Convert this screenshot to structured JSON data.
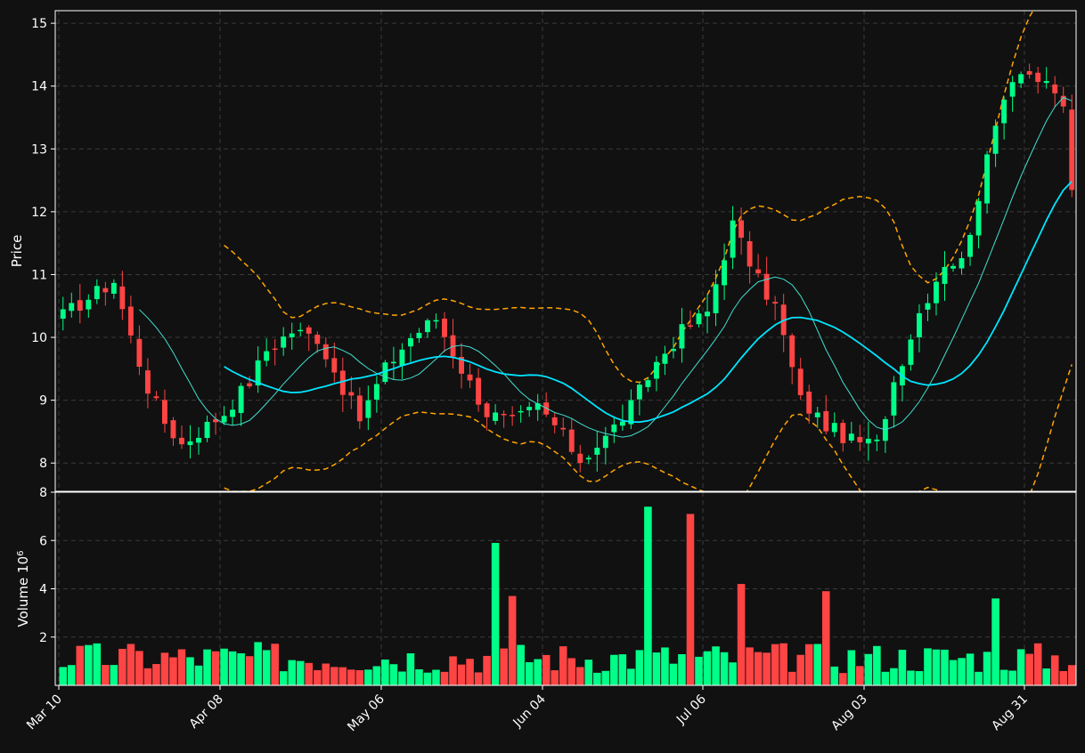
{
  "chart_data": {
    "type": "candlestick",
    "x_ticks": [
      "Mar 10",
      "Apr 08",
      "May 06",
      "Jun 04",
      "Jul 06",
      "Aug 03",
      "Aug 31"
    ],
    "panels": [
      {
        "name": "price",
        "ylabel": "Price",
        "ylim": [
          7.55,
          15.2
        ],
        "y_ticks": [
          "8",
          "9",
          "10",
          "11",
          "12",
          "13",
          "14",
          "15"
        ],
        "grid": true
      },
      {
        "name": "volume",
        "ylabel": "Volume",
        "ylabel_exponent": "6",
        "ylim": [
          0,
          8
        ],
        "y_ticks": [
          "2",
          "4",
          "6",
          "8"
        ],
        "grid": true
      }
    ],
    "colors": {
      "up": "#00ff88",
      "down": "#ff4444",
      "ma_short": "#40e0d0",
      "ma_long": "#00e5ff",
      "bands": "#ffa500",
      "grid": "#3a3a3a",
      "axis": "#ffffff"
    },
    "close_keypoints": [
      [
        0,
        10.35
      ],
      [
        6,
        10.9
      ],
      [
        8,
        10.0
      ],
      [
        10,
        9.2
      ],
      [
        12,
        8.65
      ],
      [
        14,
        8.3
      ],
      [
        19,
        8.8
      ],
      [
        22,
        9.3
      ],
      [
        24,
        9.8
      ],
      [
        27,
        10.1
      ],
      [
        30,
        10.0
      ],
      [
        33,
        9.2
      ],
      [
        35,
        8.7
      ],
      [
        38,
        9.5
      ],
      [
        41,
        10.0
      ],
      [
        44,
        10.3
      ],
      [
        47,
        9.5
      ],
      [
        50,
        8.8
      ],
      [
        53,
        8.65
      ],
      [
        56,
        8.9
      ],
      [
        58,
        8.6
      ],
      [
        61,
        8.05
      ],
      [
        64,
        8.4
      ],
      [
        67,
        8.9
      ],
      [
        70,
        9.6
      ],
      [
        73,
        10.1
      ],
      [
        76,
        10.4
      ],
      [
        79,
        11.8
      ],
      [
        82,
        10.9
      ],
      [
        84,
        10.5
      ],
      [
        87,
        9.0
      ],
      [
        90,
        8.6
      ],
      [
        93,
        8.35
      ],
      [
        96,
        8.3
      ],
      [
        98,
        9.3
      ],
      [
        101,
        10.4
      ],
      [
        104,
        11.2
      ],
      [
        106,
        11.2
      ],
      [
        109,
        12.8
      ],
      [
        111,
        13.9
      ],
      [
        113,
        14.3
      ],
      [
        115,
        14.1
      ],
      [
        118,
        13.7
      ],
      [
        119,
        12.3
      ]
    ],
    "volume_spikes": [
      {
        "index": 51,
        "value": 5.9
      },
      {
        "index": 53,
        "value": 3.7
      },
      {
        "index": 69,
        "value": 7.4
      },
      {
        "index": 74,
        "value": 7.1
      },
      {
        "index": 80,
        "value": 4.2
      },
      {
        "index": 90,
        "value": 3.9
      },
      {
        "index": 110,
        "value": 3.6
      }
    ]
  }
}
